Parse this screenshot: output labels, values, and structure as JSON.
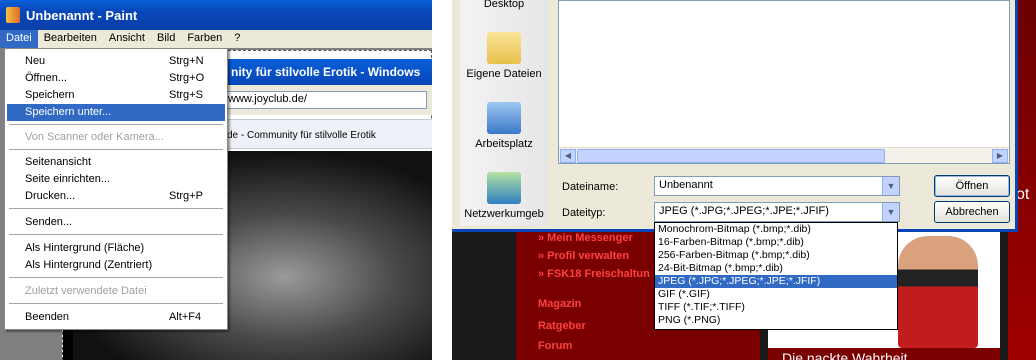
{
  "paint": {
    "title": "Unbenannt - Paint",
    "menu": [
      "Datei",
      "Bearbeiten",
      "Ansicht",
      "Bild",
      "Farben",
      "?"
    ]
  },
  "browser": {
    "title_fragment": "nity für stilvolle Erotik - Windows",
    "address": "www.joyclub.de/",
    "tab_fragment": "de - Community für stilvolle Erotik"
  },
  "datei_menu": {
    "items": [
      {
        "label": "Neu",
        "shortcut": "Strg+N"
      },
      {
        "label": "Öffnen...",
        "shortcut": "Strg+O"
      },
      {
        "label": "Speichern",
        "shortcut": "Strg+S"
      },
      {
        "label": "Speichern unter...",
        "shortcut": ""
      },
      {
        "label": "Von Scanner oder Kamera...",
        "shortcut": ""
      },
      {
        "label": "Seitenansicht",
        "shortcut": ""
      },
      {
        "label": "Seite einrichten...",
        "shortcut": ""
      },
      {
        "label": "Drucken...",
        "shortcut": "Strg+P"
      },
      {
        "label": "Senden...",
        "shortcut": ""
      },
      {
        "label": "Als Hintergrund (Fläche)",
        "shortcut": ""
      },
      {
        "label": "Als Hintergrund (Zentriert)",
        "shortcut": ""
      },
      {
        "label": "Zuletzt verwendete Datei",
        "shortcut": ""
      },
      {
        "label": "Beenden",
        "shortcut": "Alt+F4"
      }
    ]
  },
  "save_dialog": {
    "places": [
      "Desktop",
      "Eigene Dateien",
      "Arbeitsplatz",
      "Netzwerkumgeb"
    ],
    "filename_label": "Dateiname:",
    "filename_value": "Unbenannt",
    "filetype_label": "Dateityp:",
    "filetype_value": "JPEG (*.JPG;*.JPEG;*.JPE;*.JFIF)",
    "open_button": "Öffnen",
    "cancel_button": "Abbrechen",
    "filetype_options": [
      "Monochrom-Bitmap (*.bmp;*.dib)",
      "16-Farben-Bitmap (*.bmp;*.dib)",
      "256-Farben-Bitmap (*.bmp;*.dib)",
      "24-Bit-Bitmap (*.bmp;*.dib)",
      "JPEG (*.JPG;*.JPEG;*.JPE;*.JFIF)",
      "GIF (*.GIF)",
      "TIFF (*.TIF;*.TIFF)",
      "PNG (*.PNG)"
    ]
  },
  "website": {
    "links": [
      "» Mein Messenger",
      "» Profil verwalten",
      "» FSK18 Freischaltun"
    ],
    "sections": [
      "Magazin",
      "Ratgeber",
      "Forum"
    ],
    "banner_text": "Die nackte Wahrheit",
    "right_fragment": "ot"
  }
}
